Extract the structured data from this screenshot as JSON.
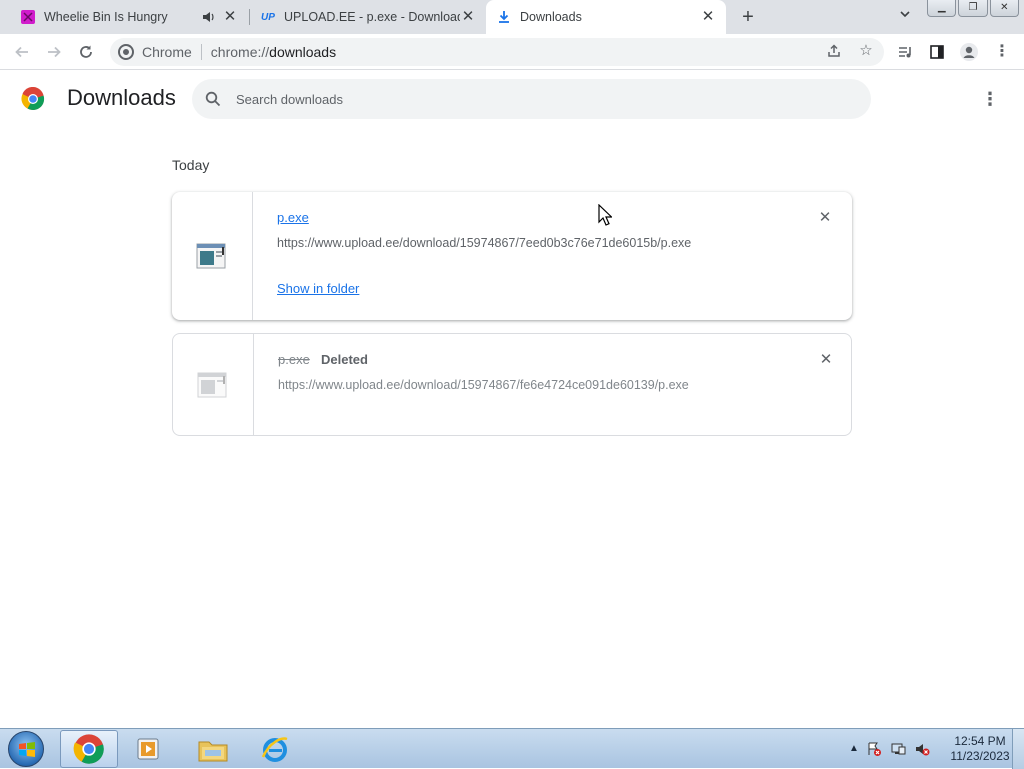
{
  "tabs": [
    {
      "title": "Wheelie Bin Is Hungry",
      "favicon": "game-favicon",
      "audio_icon": "speaker-icon",
      "active": false
    },
    {
      "title": "UPLOAD.EE - p.exe - Download",
      "favicon": "upload-ee-favicon",
      "favicon_text": "UP",
      "active": false
    },
    {
      "title": "Downloads",
      "favicon": "download-icon",
      "active": true
    }
  ],
  "toolbar": {
    "omnibox_label": "Chrome",
    "url_scheme": "chrome://",
    "url_host": "downloads"
  },
  "page": {
    "title": "Downloads",
    "search_placeholder": "Search downloads",
    "section_date": "Today"
  },
  "downloads": [
    {
      "name": "p.exe",
      "url": "https://www.upload.ee/download/15974867/7eed0b3c76e71de6015b/p.exe",
      "action": "Show in folder",
      "status": ""
    },
    {
      "name": "p.exe",
      "url": "https://www.upload.ee/download/15974867/fe6e4724ce091de60139/p.exe",
      "status": "Deleted"
    }
  ],
  "taskbar": {
    "apps": [
      "chrome-icon",
      "media-player-icon",
      "file-explorer-icon",
      "internet-explorer-icon"
    ],
    "time": "12:54 PM",
    "date": "11/23/2023"
  },
  "colors": {
    "link": "#1a73e8",
    "tabstrip": "#dee1e6"
  }
}
